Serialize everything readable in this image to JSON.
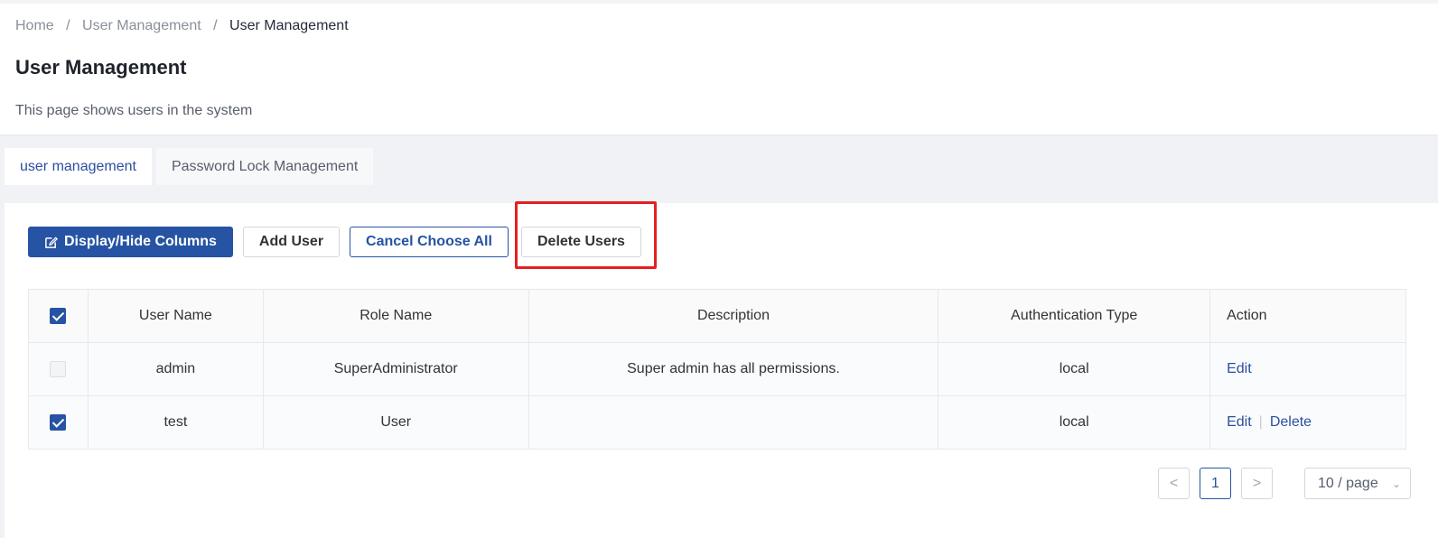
{
  "breadcrumb": {
    "home": "Home",
    "parent": "User Management",
    "current": "User Management",
    "sep": "/"
  },
  "page": {
    "title": "User Management",
    "description": "This page shows users in the system"
  },
  "tabs": [
    {
      "label": "user management",
      "active": true
    },
    {
      "label": "Password Lock Management",
      "active": false
    }
  ],
  "toolbar": {
    "display_hide_columns": "Display/Hide Columns",
    "add_user": "Add User",
    "cancel_choose_all": "Cancel Choose All",
    "delete_users": "Delete Users"
  },
  "table": {
    "columns": [
      "User Name",
      "Role Name",
      "Description",
      "Authentication Type",
      "Action"
    ],
    "rows": [
      {
        "checked": false,
        "disabled": true,
        "user_name": "admin",
        "role_name": "SuperAdministrator",
        "description": "Super admin has all permissions.",
        "auth_type": "local",
        "actions": [
          "Edit"
        ]
      },
      {
        "checked": true,
        "disabled": false,
        "user_name": "test",
        "role_name": "User",
        "description": "",
        "auth_type": "local",
        "actions": [
          "Edit",
          "Delete"
        ]
      }
    ]
  },
  "pagination": {
    "current_page": "1",
    "page_size": "10 / page",
    "prev": "<",
    "next": ">"
  },
  "colors": {
    "primary": "#2653a3",
    "highlight": "#e51f1f"
  }
}
